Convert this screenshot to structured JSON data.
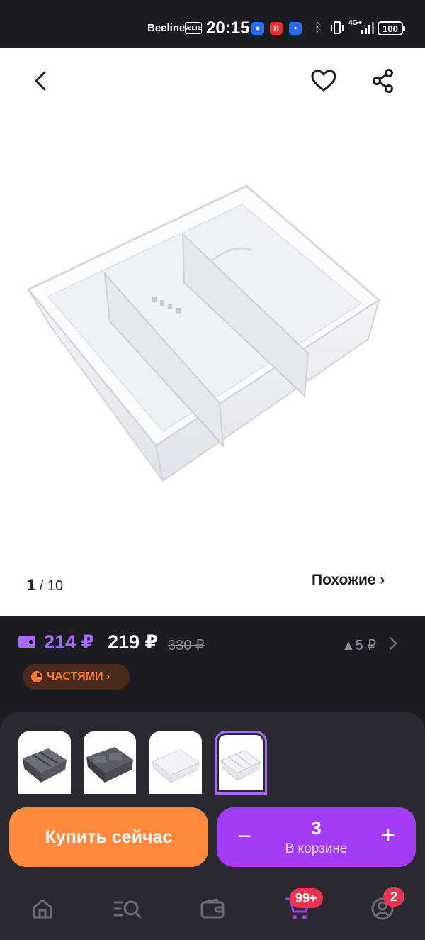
{
  "status_bar": {
    "carrier": "Beeline",
    "volte": "VoLTE",
    "time": "20:15",
    "network": "4G+",
    "battery": "100"
  },
  "gallery": {
    "current_index": "1",
    "total": "/ 10",
    "similar_link": "Похожие ›"
  },
  "price": {
    "wallet_price": "214 ₽",
    "price": "219 ₽",
    "old_price": "330 ₽",
    "delta": "▲5 ₽",
    "installments": "ЧАСТЯМИ ›"
  },
  "actions": {
    "buy_now": "Купить сейчас",
    "cart_minus": "−",
    "cart_plus": "+",
    "cart_quantity": "3",
    "cart_label": "В корзине"
  },
  "nav": {
    "cart_badge": "99+",
    "profile_badge": "2"
  },
  "colors": {
    "accent_purple": "#a23cf5",
    "wallet_purple": "#a66cff",
    "buy_orange": "#ff8a3d",
    "installment_orange": "#ff7a33",
    "badge_red": "#e8344e"
  }
}
